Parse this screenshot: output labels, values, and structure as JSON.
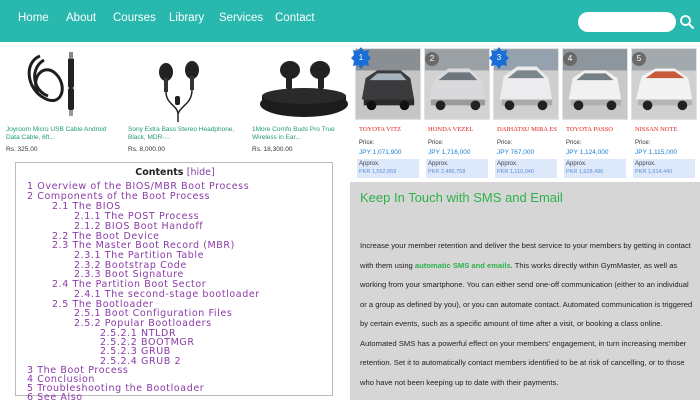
{
  "nav": {
    "items": [
      "Home",
      "About",
      "Courses",
      "Library",
      "Services",
      "Contact"
    ],
    "search_placeholder": "",
    "search_icon": "search-icon",
    "bg_color": "#28b8ad"
  },
  "products": [
    {
      "name": "Joyroom Micro USB Cable Android Data Cable, 6ft...",
      "price": "Rs. 325.00",
      "image": "usb-cable-image"
    },
    {
      "name": "Sony Extra Bass Stereo Headphone, Black, MDR-...",
      "price": "Rs. 8,000.00",
      "image": "wired-earphones-image"
    },
    {
      "name": "1More Comfo Buds Pro True Wireless in Ear...",
      "price": "Rs. 18,300.00",
      "image": "wireless-earbuds-image"
    }
  ],
  "cars": [
    {
      "rank": "1",
      "name": "TOYOTA VITZ",
      "price_label": "Price:",
      "price": "JPY 1,071,900",
      "approx_label": "Approx.",
      "approx": "PKR 1,552,659"
    },
    {
      "rank": "2",
      "name": "HONDA VEZEL",
      "price_label": "Price:",
      "price": "JPY 1,716,000",
      "approx_label": "Approx.",
      "approx": "PKR 2,485,758"
    },
    {
      "rank": "3",
      "name": "DAIHATSU MIRA ES",
      "price_label": "Price:",
      "price": "JPY 767,000",
      "approx_label": "Approx.",
      "approx": "PKR 1,110,940"
    },
    {
      "rank": "4",
      "name": "TOYOTA PASSO",
      "price_label": "Price:",
      "price": "JPY 1,124,000",
      "approx_label": "Approx.",
      "approx": "PKR 1,628,496"
    },
    {
      "rank": "5",
      "name": "NISSAN NOTE",
      "price_label": "Price:",
      "price": "JPY 1,115,000",
      "approx_label": "Approx.",
      "approx": "PKR 1,614,440"
    }
  ],
  "toc": {
    "title": "Contents",
    "hide_label": "[hide]",
    "lines": [
      "1 Overview of the BIOS/MBR Boot Process",
      "2 Components of the Boot Process",
      "2.1 The BIOS",
      "2.1.1 The POST Process",
      "2.1.2 BIOS Boot Handoff",
      "2.2 The Boot Device",
      "2.3 The Master Boot Record (MBR)",
      "2.3.1 The Partition Table",
      "2.3.2 Bootstrap Code",
      "2.3.3 Boot Signature",
      "2.4 The Partition Boot Sector",
      "2.4.1 The second-stage bootloader",
      "2.5 The Bootloader",
      "2.5.1 Boot Configuration Files",
      "2.5.2 Popular Bootloaders",
      "2.5.2.1 NTLDR",
      "2.5.2.2 BOOTMGR",
      "2.5.2.3 GRUB",
      "2.5.2.4 GRUB 2",
      "3 The Boot Process",
      "4 Conclusion",
      "5 Troubleshooting the Bootloader",
      "6 See Also"
    ]
  },
  "sms": {
    "title": "Keep In Touch with SMS and Email",
    "text_before": "Increase your member retention and deliver the best service to your members by getting in contact with them using ",
    "highlight": "automatic SMS and emails",
    "text_after": ". This works directly within GymMaster, as well as working from your smartphone. You can either send one-off communication (either to an individual or a group as defined by you), or you can automate contact. Automated communication is triggered by certain events, such as a specific amount of time after a visit, or booking a class online. Automated SMS has a powerful effect on your members' engagement, in turn increasing member retention. Set it to automatically contact members identified to be at risk of cancelling, or to those who have not been keeping up to date with their payments.",
    "title_color": "#2db24a"
  }
}
